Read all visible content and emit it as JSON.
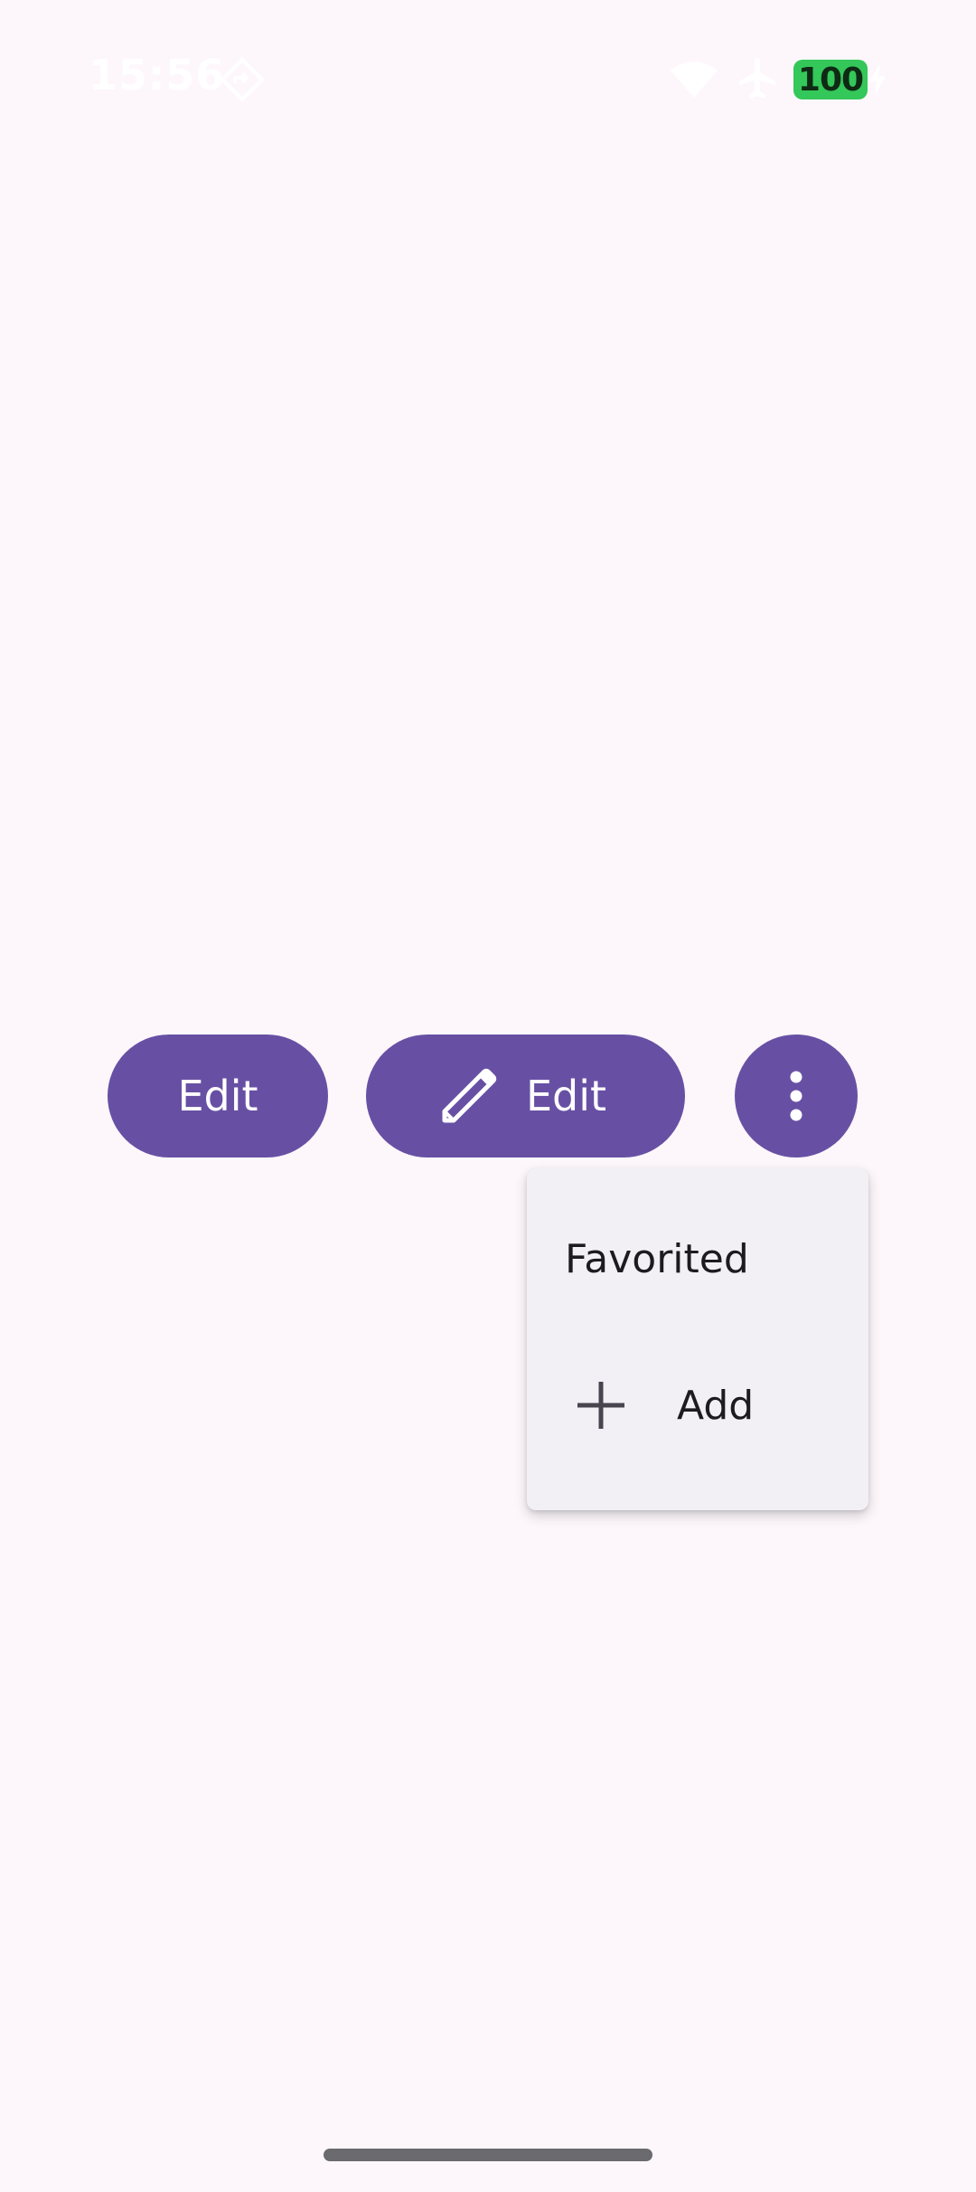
{
  "status_bar": {
    "time": "15:56",
    "battery_level": "100",
    "icons": [
      "location-icon",
      "wifi-icon",
      "airplane-icon",
      "battery-icon",
      "charging-bolt-icon"
    ]
  },
  "buttons": {
    "edit_text_label": "Edit",
    "edit_icon_label": "Edit",
    "edit_icon": "pencil-icon",
    "more_icon": "more-vertical-icon"
  },
  "menu": {
    "items": [
      {
        "label": "Favorited"
      },
      {
        "label": "Add",
        "icon": "plus-icon"
      }
    ]
  },
  "colors": {
    "background": "#fdf7fb",
    "primary": "#6750a4",
    "on_primary": "#ffffff",
    "menu_surface": "#f2eff5",
    "battery": "#34c759"
  }
}
